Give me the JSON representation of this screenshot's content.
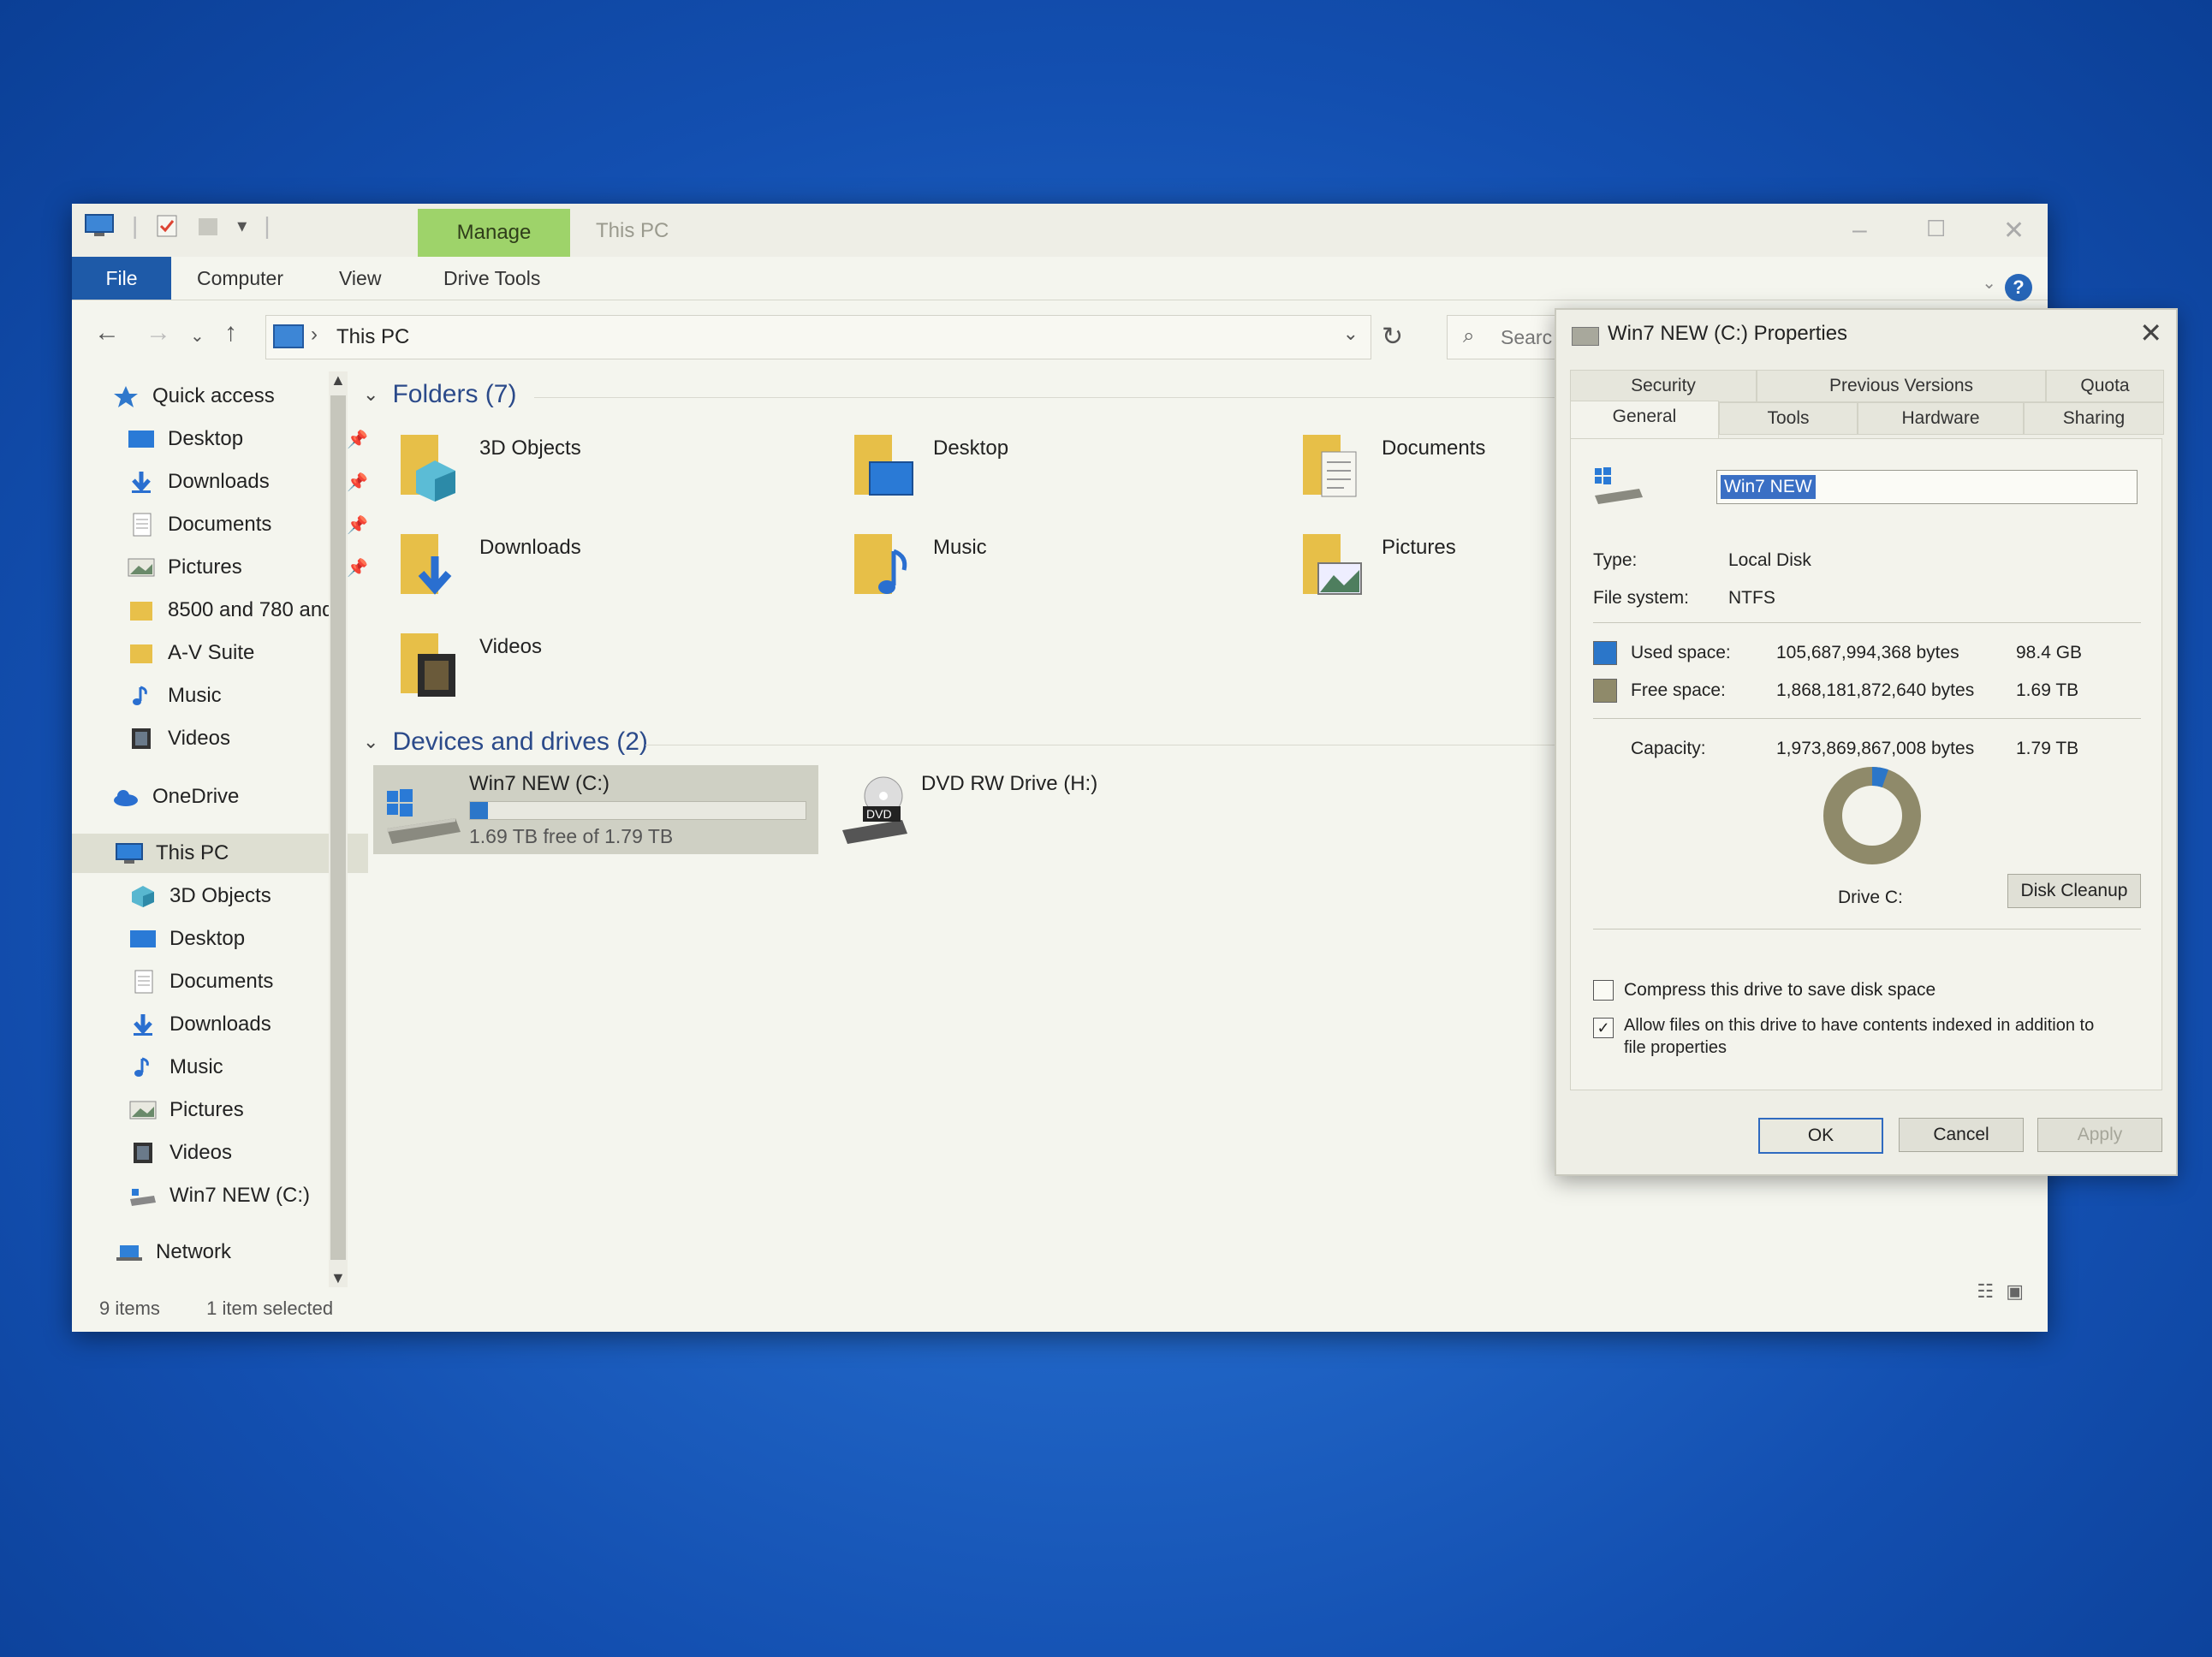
{
  "explorer": {
    "title": "This PC",
    "contextual_tab": "Manage",
    "ribbon_tabs": [
      "File",
      "Computer",
      "View",
      "Drive Tools"
    ],
    "address": {
      "path": "This PC"
    },
    "search": {
      "placeholder": "Search This PC",
      "visible": "Searc"
    },
    "nav": {
      "quick_access": "Quick access",
      "quick_items": [
        "Desktop",
        "Downloads",
        "Documents",
        "Pictures",
        "8500 and 780 and",
        "A-V Suite",
        "Music",
        "Videos"
      ],
      "onedrive": "OneDrive",
      "this_pc": "This PC",
      "this_pc_items": [
        "3D Objects",
        "Desktop",
        "Documents",
        "Downloads",
        "Music",
        "Pictures",
        "Videos",
        "Win7 NEW (C:)"
      ],
      "network": "Network"
    },
    "folders_header": "Folders (7)",
    "folders": [
      "3D Objects",
      "Desktop",
      "Documents",
      "Downloads",
      "Music",
      "Pictures",
      "Videos"
    ],
    "devices_header": "Devices and drives (2)",
    "drives": [
      {
        "name": "Win7 NEW (C:)",
        "sub": "1.69 TB free of 1.79 TB",
        "used_fraction": 0.054
      },
      {
        "name": "DVD RW Drive (H:)"
      }
    ],
    "status": {
      "items": "9 items",
      "selected": "1 item selected"
    }
  },
  "dialog": {
    "title": "Win7 NEW (C:) Properties",
    "tabs_top": [
      "Security",
      "Previous Versions",
      "Quota"
    ],
    "tabs_bottom": [
      "General",
      "Tools",
      "Hardware",
      "Sharing"
    ],
    "volume_name": "Win7 NEW",
    "type_label": "Type:",
    "type_value": "Local Disk",
    "fs_label": "File system:",
    "fs_value": "NTFS",
    "used_label": "Used space:",
    "used_bytes": "105,687,994,368 bytes",
    "used_human": "98.4 GB",
    "free_label": "Free space:",
    "free_bytes": "1,868,181,872,640 bytes",
    "free_human": "1.69 TB",
    "capacity_label": "Capacity:",
    "capacity_bytes": "1,973,869,867,008 bytes",
    "capacity_human": "1.79 TB",
    "drive_label": "Drive C:",
    "cleanup": "Disk Cleanup",
    "compress": "Compress this drive to save disk space",
    "index_line1": "Allow files on this drive to have contents indexed in addition to",
    "index_line2": "file properties",
    "ok": "OK",
    "cancel": "Cancel",
    "apply": "Apply",
    "used_fraction": 0.054,
    "colors": {
      "used": "#2b76c9",
      "free": "#8f8a6a"
    }
  }
}
